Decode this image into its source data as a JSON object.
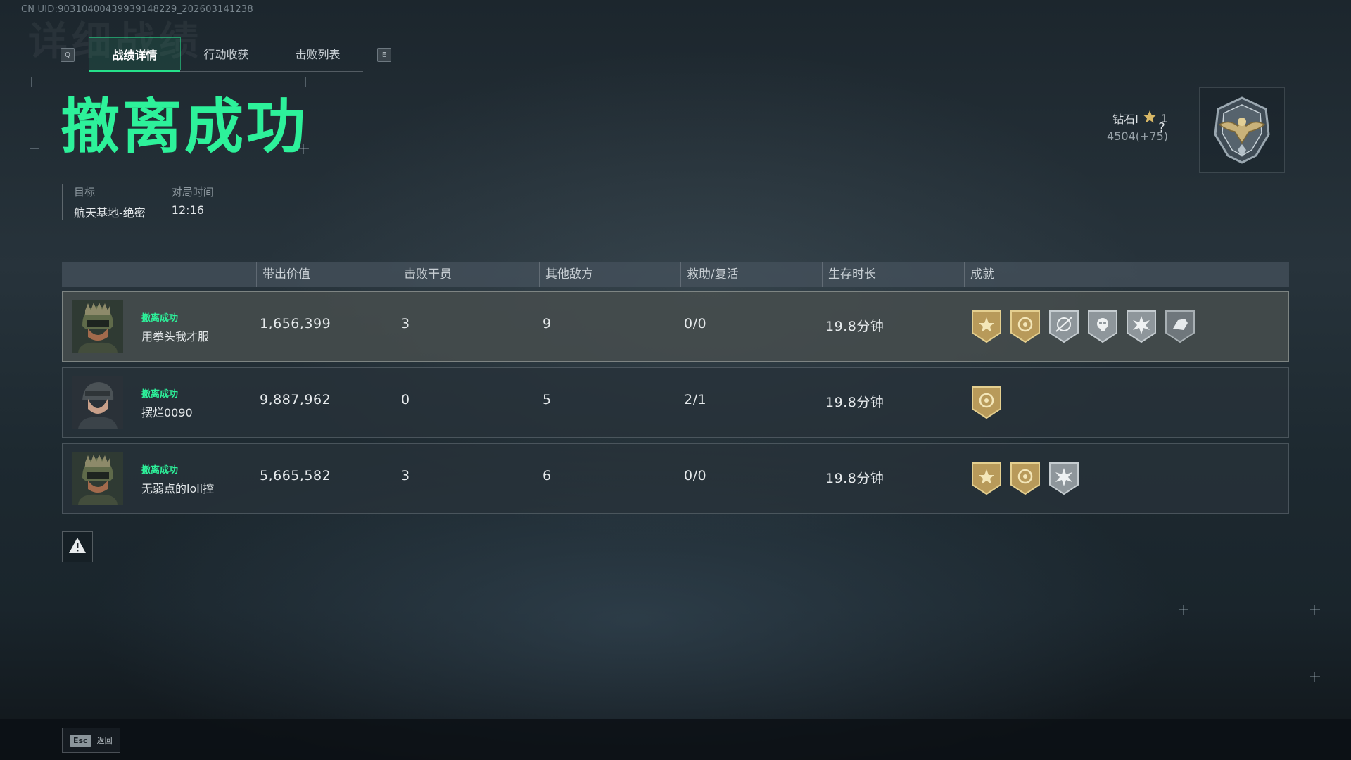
{
  "uid_text": "CN UID:903104004399391482​29_202603141238",
  "tabs": {
    "left_key": "Q",
    "right_key": "E",
    "items": [
      {
        "label": "战绩详情",
        "active": true
      },
      {
        "label": "行动收获",
        "active": false
      },
      {
        "label": "击败列表",
        "active": false
      }
    ]
  },
  "title": "撤离成功",
  "info": {
    "target_label": "目标",
    "target_value": "航天基地-绝密",
    "time_label": "对局时间",
    "time_value": "12:16"
  },
  "rank": {
    "name": "钻石I",
    "stars": "1",
    "points": "4504(+75)",
    "help": "?"
  },
  "table": {
    "headers": [
      "带出价值",
      "击败干员",
      "其他敌方",
      "救助/复活",
      "生存时长",
      "成就"
    ],
    "rows": [
      {
        "status": "撤离成功",
        "name": "用拳头我才服",
        "value": "1,656,399",
        "kills": "3",
        "others": "9",
        "assist": "0/0",
        "survival": "19.8分钟",
        "medals": [
          "gold-sun-medal-icon",
          "gold-target-medal-icon",
          "silver-crosshair-medal-icon",
          "silver-skull-medal-icon",
          "silver-star-medal-icon",
          "silver-hand-medal-icon"
        ],
        "highlight": true
      },
      {
        "status": "撤离成功",
        "name": "摆烂0090",
        "value": "9,887,962",
        "kills": "0",
        "others": "5",
        "assist": "2/1",
        "survival": "19.8分钟",
        "medals": [
          "gold-target-medal-icon"
        ],
        "highlight": false
      },
      {
        "status": "撤离成功",
        "name": "无弱点的loli控",
        "value": "5,665,582",
        "kills": "3",
        "others": "6",
        "assist": "0/0",
        "survival": "19.8分钟",
        "medals": [
          "gold-sun-medal-icon",
          "gold-target-medal-icon",
          "silver-star-medal-icon"
        ],
        "highlight": false
      }
    ]
  },
  "footer": {
    "esc_key": "Esc",
    "esc_label": "返回"
  },
  "colors": {
    "accent_green": "#2df19a",
    "gold_medal": "#b89a5a",
    "silver_medal": "#8e969b"
  }
}
